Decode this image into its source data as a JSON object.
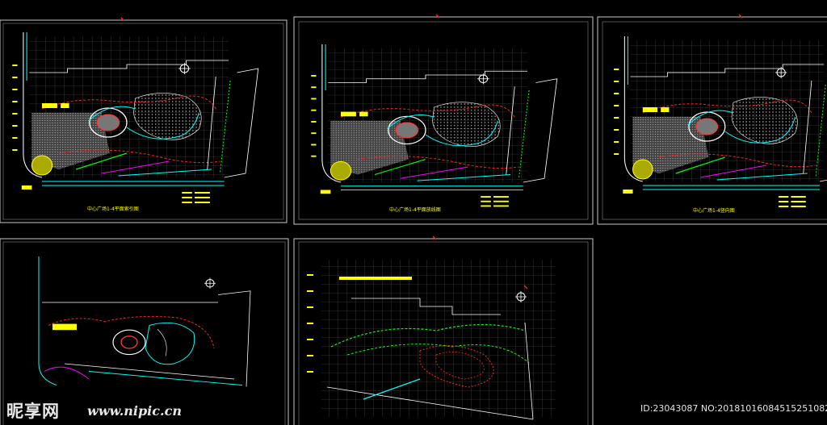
{
  "sheets": [
    {
      "id": "sheet-1",
      "title_text": "中心广场1-4平面索引图"
    },
    {
      "id": "sheet-2",
      "title_text": "中心广场1-4平面放线图"
    },
    {
      "id": "sheet-3",
      "title_text": "中心广场1-4竖向图"
    },
    {
      "id": "sheet-4",
      "title_text": ""
    },
    {
      "id": "sheet-5",
      "title_text": ""
    }
  ],
  "watermark": {
    "brand": "昵享网",
    "url": "www.nipic.cn",
    "id_text": "ID:23043087 NO:20181016084515251082"
  },
  "colors": {
    "background": "#000000",
    "sheet_border": "#c8c8c8",
    "grid": "#5a5a5a",
    "yellow": "#ffff00",
    "green": "#00ff00",
    "cyan": "#00ffff",
    "red": "#ff2020",
    "magenta": "#ff00ff",
    "white": "#ffffff"
  }
}
